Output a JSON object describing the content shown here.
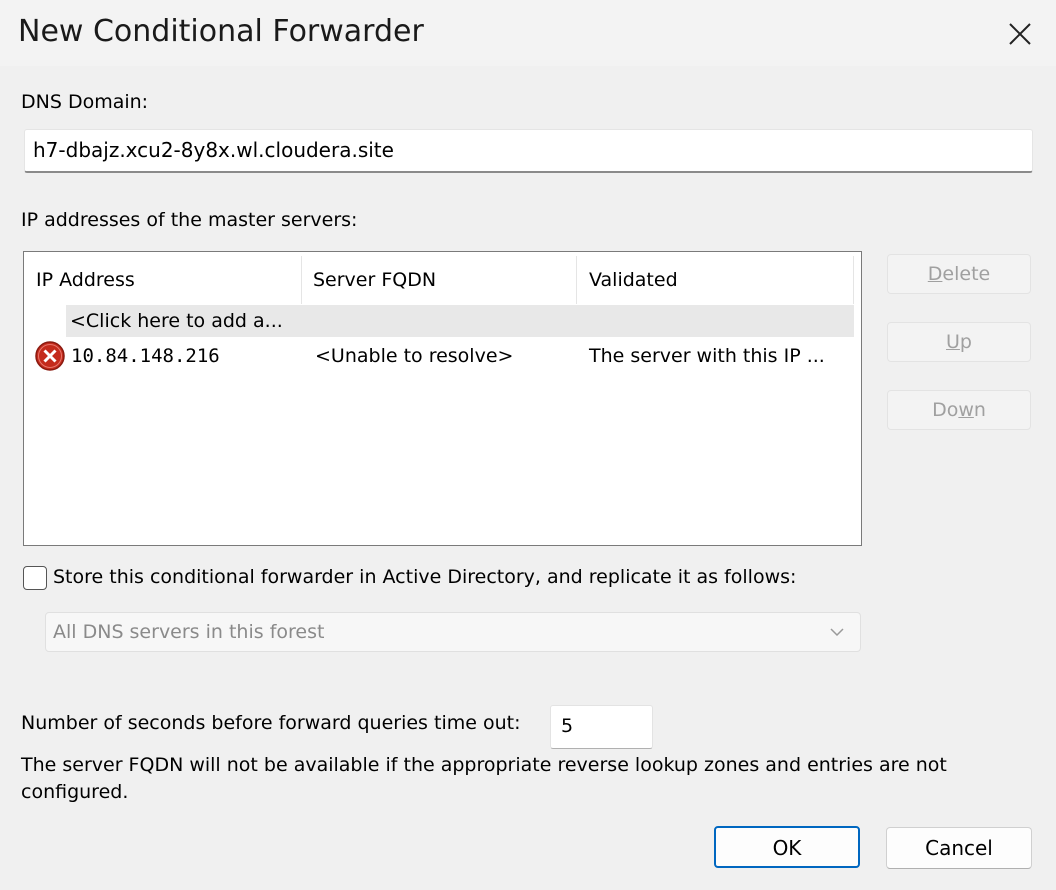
{
  "window": {
    "title": "New Conditional Forwarder",
    "close_icon": "close-icon"
  },
  "dns_domain": {
    "label": "DNS Domain:",
    "value": "h7-dbajz.xcu2-8y8x.wl.cloudera.site"
  },
  "master_servers": {
    "label": "IP addresses of the master servers:",
    "columns": [
      "IP Address",
      "Server FQDN",
      "Validated"
    ],
    "add_row_text": "<Click here to add a...",
    "rows": [
      {
        "status_icon": "error-icon",
        "ip": "10.84.148.216",
        "fqdn": "<Unable to resolve>",
        "validated": "The server with this IP ..."
      }
    ]
  },
  "side_buttons": {
    "delete": {
      "accel": "D",
      "rest": "elete"
    },
    "up": {
      "accel": "U",
      "rest": "p"
    },
    "down": {
      "pre": "Do",
      "accel": "w",
      "rest": "n"
    }
  },
  "store_ad": {
    "checked": false,
    "label": "Store this conditional forwarder in Active Directory, and replicate it as follows:"
  },
  "replication": {
    "selected": "All DNS servers in this forest",
    "disabled": true
  },
  "timeout": {
    "label": "Number of seconds before forward queries time out:",
    "value": "5"
  },
  "note": {
    "line1": "The server FQDN will not be available if the appropriate reverse lookup zones and entries are not",
    "line2": "configured."
  },
  "buttons": {
    "ok": "OK",
    "cancel": "Cancel"
  },
  "colors": {
    "accent": "#0067c0",
    "error": "#d13438",
    "disabled_text": "#a0a0a0"
  }
}
